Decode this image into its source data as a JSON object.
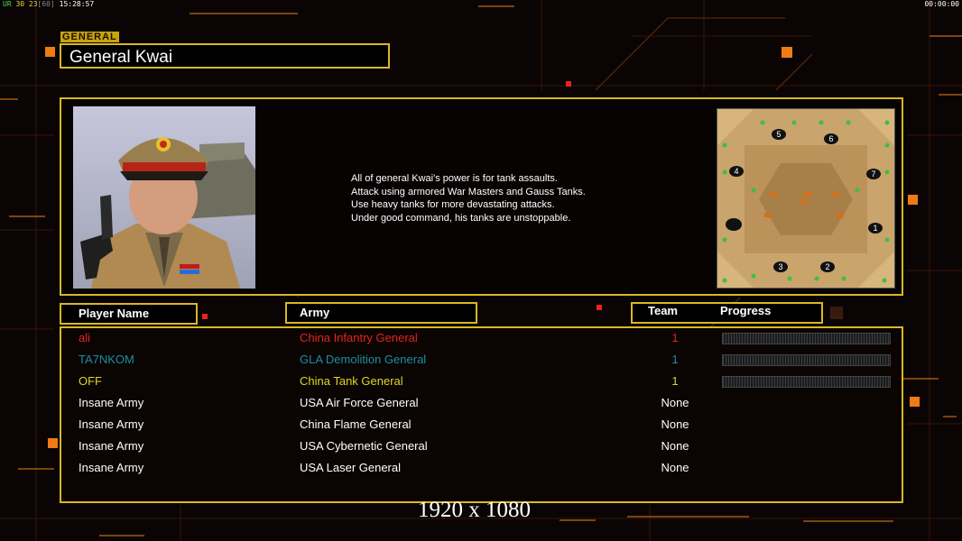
{
  "hud": {
    "top_left_parts": [
      "UR",
      " 30 23",
      "[60]",
      " 15:28:57"
    ],
    "top_right": "00:00:00"
  },
  "general": {
    "section_label": "GENERAL",
    "name": "General Kwai",
    "description": [
      "All of general Kwai's power is for tank assaults.",
      "Attack using armored War Masters and Gauss Tanks.",
      "Use heavy tanks for more devastating attacks.",
      "Under good command, his tanks are unstoppable."
    ]
  },
  "map": {
    "start_positions": [
      "5",
      "6",
      "4",
      "7",
      "1",
      "3",
      "2"
    ]
  },
  "headers": {
    "player_name": "Player Name",
    "army": "Army",
    "team": "Team",
    "progress": "Progress"
  },
  "players": [
    {
      "name": "ali",
      "army": "China Infantry General",
      "team": "1",
      "color": "#e8231c",
      "progress": 0
    },
    {
      "name": "TA7NKOM",
      "army": "GLA Demolition General",
      "team": "1",
      "color": "#1a8fa3",
      "progress": 0
    },
    {
      "name": "OFF",
      "army": "China Tank General",
      "team": "1",
      "color": "#e3d424",
      "progress": 0
    },
    {
      "name": "Insane Army",
      "army": "USA Air Force General",
      "team": "None",
      "color": "#ffffff"
    },
    {
      "name": "Insane Army",
      "army": "China Flame General",
      "team": "None",
      "color": "#ffffff"
    },
    {
      "name": "Insane Army",
      "army": "USA Cybernetic General",
      "team": "None",
      "color": "#ffffff"
    },
    {
      "name": "Insane Army",
      "army": "USA Laser General",
      "team": "None",
      "color": "#ffffff"
    }
  ],
  "watermark": "1920 x 1080",
  "colors": {
    "accent": "#d8b823",
    "ai": "#ffffff"
  }
}
